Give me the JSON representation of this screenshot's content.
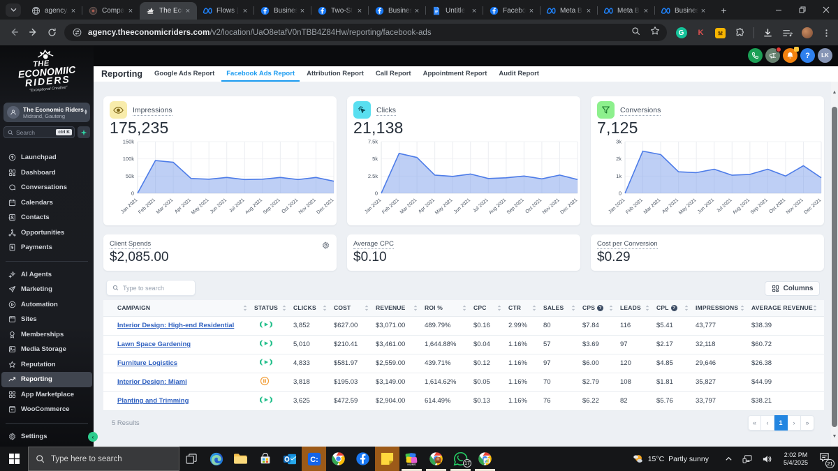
{
  "browser": {
    "tab_search_icon": "chevron-down",
    "tabs": [
      {
        "title": "agency.",
        "icon": "globe",
        "active": false
      },
      {
        "title": "Compa",
        "icon": "dark-dot",
        "active": false
      },
      {
        "title": "The Eco",
        "icon": "riders",
        "active": true
      },
      {
        "title": "Flows |",
        "icon": "meta",
        "active": false
      },
      {
        "title": "Busines",
        "icon": "facebook",
        "active": false
      },
      {
        "title": "Two-St",
        "icon": "facebook",
        "active": false
      },
      {
        "title": "Busines",
        "icon": "facebook",
        "active": false
      },
      {
        "title": "Untitle",
        "icon": "docs",
        "active": false
      },
      {
        "title": "Facebo",
        "icon": "facebook",
        "active": false
      },
      {
        "title": "Meta B",
        "icon": "meta",
        "active": false
      },
      {
        "title": "Meta B",
        "icon": "meta",
        "active": false
      },
      {
        "title": "Busines",
        "icon": "meta",
        "active": false
      }
    ],
    "new_tab_label": "+",
    "window_controls": [
      "minimize",
      "restore",
      "close"
    ],
    "url_domain": "agency.theeconomicriders.com",
    "url_path": "/v2/location/UaO8etafV0nTBB4Z84Hw/reporting/facebook-ads",
    "extension_k_label": "K"
  },
  "sidebar": {
    "logo_line1": "THE",
    "logo_line2": "ECONOMIIC",
    "logo_line3": "RIDERS",
    "logo_tagline": "\"Exceptional Creative\"",
    "account_name": "The Economic Riders",
    "account_location": "Midrand, Gauteng",
    "search_placeholder": "Search",
    "search_shortcut": "ctrl K",
    "nav": [
      {
        "label": "Launchpad",
        "icon": "launchpad",
        "active": false,
        "div_after": false
      },
      {
        "label": "Dashboard",
        "icon": "dashboard",
        "active": false,
        "div_after": false
      },
      {
        "label": "Conversations",
        "icon": "conversations",
        "active": false,
        "div_after": false
      },
      {
        "label": "Calendars",
        "icon": "calendars",
        "active": false,
        "div_after": false
      },
      {
        "label": "Contacts",
        "icon": "contacts",
        "active": false,
        "div_after": false
      },
      {
        "label": "Opportunities",
        "icon": "opportunities",
        "active": false,
        "div_after": false
      },
      {
        "label": "Payments",
        "icon": "payments",
        "active": false,
        "div_after": true
      },
      {
        "label": "AI Agents",
        "icon": "ai-agents",
        "active": false,
        "div_after": false
      },
      {
        "label": "Marketing",
        "icon": "marketing",
        "active": false,
        "div_after": false
      },
      {
        "label": "Automation",
        "icon": "automation",
        "active": false,
        "div_after": false
      },
      {
        "label": "Sites",
        "icon": "sites",
        "active": false,
        "div_after": false
      },
      {
        "label": "Memberships",
        "icon": "memberships",
        "active": false,
        "div_after": false
      },
      {
        "label": "Media Storage",
        "icon": "media-storage",
        "active": false,
        "div_after": false
      },
      {
        "label": "Reputation",
        "icon": "reputation",
        "active": false,
        "div_after": false
      },
      {
        "label": "Reporting",
        "icon": "reporting",
        "active": true,
        "div_after": false
      },
      {
        "label": "App Marketplace",
        "icon": "app-marketplace",
        "active": false,
        "div_after": false
      },
      {
        "label": "WooCommerce",
        "icon": "woocommerce",
        "active": false,
        "div_after": true
      },
      {
        "label": "Settings",
        "icon": "settings",
        "active": false,
        "div_after": false
      }
    ]
  },
  "app_header": {
    "icons": [
      {
        "name": "phone",
        "bg": "#1ba055"
      },
      {
        "name": "megaphone",
        "bg": "#67816f",
        "badge": "red-dot"
      },
      {
        "name": "bell",
        "bg": "#f2820f",
        "badge": "yellow-square"
      },
      {
        "name": "help",
        "bg": "#2f80ed",
        "text": "?"
      },
      {
        "name": "avatar",
        "bg": "#8695b5",
        "text": "LK"
      }
    ]
  },
  "page": {
    "title": "Reporting",
    "tabs": [
      {
        "label": "Google Ads Report",
        "active": false
      },
      {
        "label": "Facebook Ads Report",
        "active": true
      },
      {
        "label": "Attribution Report",
        "active": false
      },
      {
        "label": "Call Report",
        "active": false
      },
      {
        "label": "Appointment Report",
        "active": false
      },
      {
        "label": "Audit Report",
        "active": false
      }
    ]
  },
  "stat_cards": [
    {
      "label": "Impressions",
      "value": "175,235",
      "icon": "eye",
      "icon_bg": "#f8ecab",
      "icon_color": "#7d6414"
    },
    {
      "label": "Clicks",
      "value": "21,138",
      "icon": "cursor-click",
      "icon_bg": "#59dff0",
      "icon_color": "#0c4e59"
    },
    {
      "label": "Conversions",
      "value": "7,125",
      "icon": "funnel",
      "icon_bg": "#8df08d",
      "icon_color": "#1d7a2e"
    }
  ],
  "chart_data": [
    {
      "type": "area",
      "title": "Impressions",
      "x": [
        "Jan 2021",
        "Feb 2021",
        "Mar 2021",
        "Apr 2021",
        "May 2021",
        "Jun 2021",
        "Jul 2021",
        "Aug 2021",
        "Sep 2021",
        "Oct 2021",
        "Nov 2021",
        "Dec 2021"
      ],
      "values": [
        0,
        95000,
        90000,
        43000,
        41000,
        46000,
        40000,
        41000,
        46000,
        40000,
        46000,
        35000
      ],
      "ylim": [
        0,
        150000
      ],
      "yticks": [
        "150k",
        "100k",
        "50k",
        "0"
      ],
      "line_color": "#4d7ce8",
      "fill_color": "rgba(125,160,235,0.5)",
      "grid": "vertical"
    },
    {
      "type": "area",
      "title": "Clicks",
      "x": [
        "Jan 2021",
        "Feb 2021",
        "Mar 2021",
        "Apr 2021",
        "May 2021",
        "Jun 2021",
        "Jul 2021",
        "Aug 2021",
        "Sep 2021",
        "Oct 2021",
        "Nov 2021",
        "Dec 2021"
      ],
      "values": [
        0,
        5800,
        5200,
        2650,
        2450,
        2800,
        2150,
        2250,
        2500,
        2100,
        2650,
        2000
      ],
      "ylim": [
        0,
        7500
      ],
      "yticks": [
        "7.5k",
        "5k",
        "2.5k",
        "0"
      ],
      "line_color": "#4d7ce8",
      "fill_color": "rgba(125,160,235,0.5)",
      "grid": "vertical"
    },
    {
      "type": "area",
      "title": "Conversions",
      "x": [
        "Jan 2021",
        "Feb 2021",
        "Mar 2021",
        "Apr 2021",
        "May 2021",
        "Jun 2021",
        "Jul 2021",
        "Aug 2021",
        "Sep 2021",
        "Oct 2021",
        "Nov 2021",
        "Dec 2021"
      ],
      "values": [
        0,
        2450,
        2250,
        1250,
        1200,
        1400,
        1050,
        1100,
        1400,
        1000,
        1600,
        900
      ],
      "ylim": [
        0,
        3000
      ],
      "yticks": [
        "3k",
        "2k",
        "1k",
        "0"
      ],
      "line_color": "#4d7ce8",
      "fill_color": "rgba(125,160,235,0.5)",
      "grid": "vertical"
    }
  ],
  "metric_cards": [
    {
      "label": "Client Spends",
      "value": "$2,085.00",
      "gear": true
    },
    {
      "label": "Average CPC",
      "value": "$0.10",
      "gear": false
    },
    {
      "label": "Cost per Conversion",
      "value": "$0.29",
      "gear": false
    }
  ],
  "table": {
    "search_placeholder": "Type to search",
    "columns_button_label": "Columns",
    "headers": [
      {
        "label": "CAMPAIGN",
        "info": false
      },
      {
        "label": "STATUS",
        "info": false
      },
      {
        "label": "CLICKS",
        "info": false
      },
      {
        "label": "COST",
        "info": false
      },
      {
        "label": "REVENUE",
        "info": false
      },
      {
        "label": "ROI %",
        "info": false
      },
      {
        "label": "CPC",
        "info": false
      },
      {
        "label": "CTR",
        "info": false
      },
      {
        "label": "SALES",
        "info": false
      },
      {
        "label": "CPS",
        "info": true
      },
      {
        "label": "LEADS",
        "info": false
      },
      {
        "label": "CPL",
        "info": true
      },
      {
        "label": "IMPRESSIONS",
        "info": false
      },
      {
        "label": "AVERAGE REVENUE",
        "info": false
      }
    ],
    "rows": [
      {
        "campaign": "Interior Design: High-end Residential",
        "status": "active",
        "cells": [
          "3,852",
          "$627.00",
          "$3,071.00",
          "489.79%",
          "$0.16",
          "2.99%",
          "80",
          "$7.84",
          "116",
          "$5.41",
          "43,777",
          "$38.39"
        ]
      },
      {
        "campaign": "Lawn Space Gardening",
        "status": "active",
        "cells": [
          "5,010",
          "$210.41",
          "$3,461.00",
          "1,644.88%",
          "$0.04",
          "1.16%",
          "57",
          "$3.69",
          "97",
          "$2.17",
          "32,118",
          "$60.72"
        ]
      },
      {
        "campaign": "Furniture Logistics",
        "status": "active",
        "cells": [
          "4,833",
          "$581.97",
          "$2,559.00",
          "439.71%",
          "$0.12",
          "1.16%",
          "97",
          "$6.00",
          "120",
          "$4.85",
          "29,646",
          "$26.38"
        ]
      },
      {
        "campaign": "Interior Design: Miami",
        "status": "paused",
        "cells": [
          "3,818",
          "$195.03",
          "$3,149.00",
          "1,614.62%",
          "$0.05",
          "1.16%",
          "70",
          "$2.79",
          "108",
          "$1.81",
          "35,827",
          "$44.99"
        ]
      },
      {
        "campaign": "Planting and Trimming",
        "status": "active",
        "cells": [
          "3,625",
          "$472.59",
          "$2,904.00",
          "614.49%",
          "$0.13",
          "1.16%",
          "76",
          "$6.22",
          "82",
          "$5.76",
          "33,797",
          "$38.21"
        ]
      }
    ],
    "results_text": "5 Results",
    "pagination": [
      {
        "label": "«",
        "active": false
      },
      {
        "label": "‹",
        "active": false
      },
      {
        "label": "1",
        "active": true
      },
      {
        "label": "›",
        "active": false
      },
      {
        "label": "»",
        "active": false
      }
    ]
  },
  "taskbar": {
    "search_placeholder": "Type here to search",
    "app_icons": [
      {
        "name": "task-view",
        "flash": false,
        "open": false
      },
      {
        "name": "edge",
        "flash": false,
        "open": false
      },
      {
        "name": "file-explorer",
        "flash": false,
        "open": false
      },
      {
        "name": "store",
        "flash": false,
        "open": false
      },
      {
        "name": "outlook",
        "flash": false,
        "open": false
      },
      {
        "name": "c-drive-app",
        "flash": true,
        "open": false
      },
      {
        "name": "chrome",
        "flash": false,
        "open": false
      },
      {
        "name": "facebook",
        "flash": false,
        "open": false
      },
      {
        "name": "sticky-notes",
        "flash": true,
        "open": false
      },
      {
        "name": "mums-app",
        "flash": false,
        "open": true
      },
      {
        "name": "chrome-profile",
        "flash": false,
        "open": true
      },
      {
        "name": "whatsapp",
        "flash": false,
        "open": true,
        "badge": "17"
      },
      {
        "name": "chrome-ads",
        "flash": false,
        "open": true
      }
    ],
    "weather_temp": "15°C",
    "weather_desc": "Partly sunny",
    "time": "2:02 PM",
    "date": "5/4/2025",
    "notification_count": "21"
  }
}
